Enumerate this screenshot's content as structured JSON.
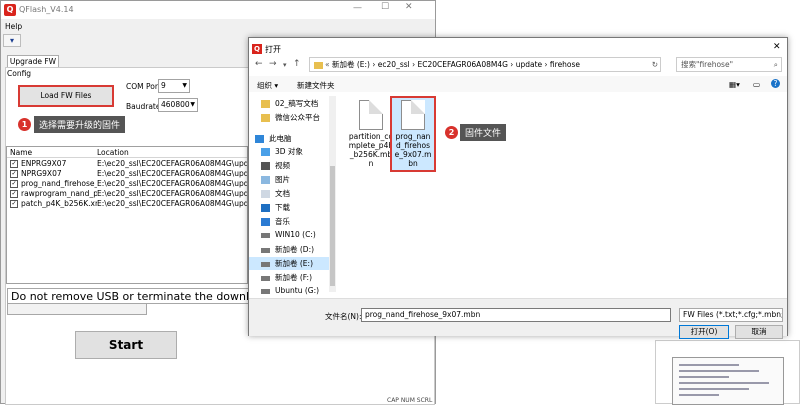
{
  "qflash": {
    "title": "QFlash_V4.14",
    "app_icon": "Q",
    "menu": "Help",
    "tool_icon": "▾",
    "tab": "Upgrade FW",
    "config_label": "Config",
    "load_button": "Load FW Files",
    "com_port_label": "COM Port:",
    "com_port_value": "9",
    "baudrate_label": "Baudrate:",
    "baudrate_value": "460800",
    "step1_num": "1",
    "step1_text": "选择需要升级的固件",
    "col_name": "Name",
    "col_location": "Location",
    "rows": [
      {
        "name": "ENPRG9X07",
        "loc": "E:\\ec20_ssl\\EC20CEFAGR06A08M4G\\update\\ENPRG9X07"
      },
      {
        "name": "NPRG9X07",
        "loc": "E:\\ec20_ssl\\EC20CEFAGR06A08M4G\\update\\NPRG9X07"
      },
      {
        "name": "prog_nand_firehose_9...",
        "loc": "E:\\ec20_ssl\\EC20CEFAGR06A08M4G\\update\\firehose"
      },
      {
        "name": "rawprogram_nand_p4...",
        "loc": "E:\\ec20_ssl\\EC20CEFAGR06A08M4G\\update\\firehose"
      },
      {
        "name": "patch_p4K_b256K.xml",
        "loc": "E:\\ec20_ssl\\EC20CEFAGR06A08M4G\\update\\firehose"
      }
    ],
    "status_text": "Do not remove USB or terminate the downloading process",
    "start_button": "Start",
    "statusbar": "CAP  NUM  SCRL"
  },
  "dialog": {
    "title": "打开",
    "path": [
      "新加卷 (E:)",
      "ec20_ssl",
      "EC20CEFAGR06A08M4G",
      "update",
      "firehose"
    ],
    "search_placeholder": "搜索\"firehose\"",
    "organize": "组织 ▾",
    "new_folder": "新建文件夹",
    "tree": [
      {
        "label": "02_稿写文档",
        "icon": "folder"
      },
      {
        "label": "微信公众平台",
        "icon": "folder"
      },
      {
        "label": "此电脑",
        "icon": "pc"
      },
      {
        "label": "3D 对象",
        "icon": "3d"
      },
      {
        "label": "视频",
        "icon": "video"
      },
      {
        "label": "图片",
        "icon": "picture"
      },
      {
        "label": "文档",
        "icon": "document"
      },
      {
        "label": "下载",
        "icon": "download"
      },
      {
        "label": "音乐",
        "icon": "music"
      },
      {
        "label": "WIN10 (C:)",
        "icon": "drive"
      },
      {
        "label": "新加卷 (D:)",
        "icon": "drive"
      },
      {
        "label": "新加卷 (E:)",
        "icon": "drive",
        "selected": true
      },
      {
        "label": "新加卷 (F:)",
        "icon": "drive"
      },
      {
        "label": "Ubuntu (G:)",
        "icon": "drive"
      }
    ],
    "files": [
      {
        "name": "partition_complete_p4K_b256K.mbn"
      },
      {
        "name": "prog_nand_firehose_9x07.mbn"
      }
    ],
    "step2_num": "2",
    "step2_text": "固件文件",
    "filename_label": "文件名(N):",
    "filename_value": "prog_nand_firehose_9x07.mbn",
    "filetype_value": "FW Files (*.txt;*.cfg;*.mbn;*.lo",
    "open_button": "打开(O)",
    "cancel_button": "取消"
  },
  "colors": {
    "accent": "#d83a34",
    "selection": "#cce8ff",
    "callout": "#555555"
  }
}
